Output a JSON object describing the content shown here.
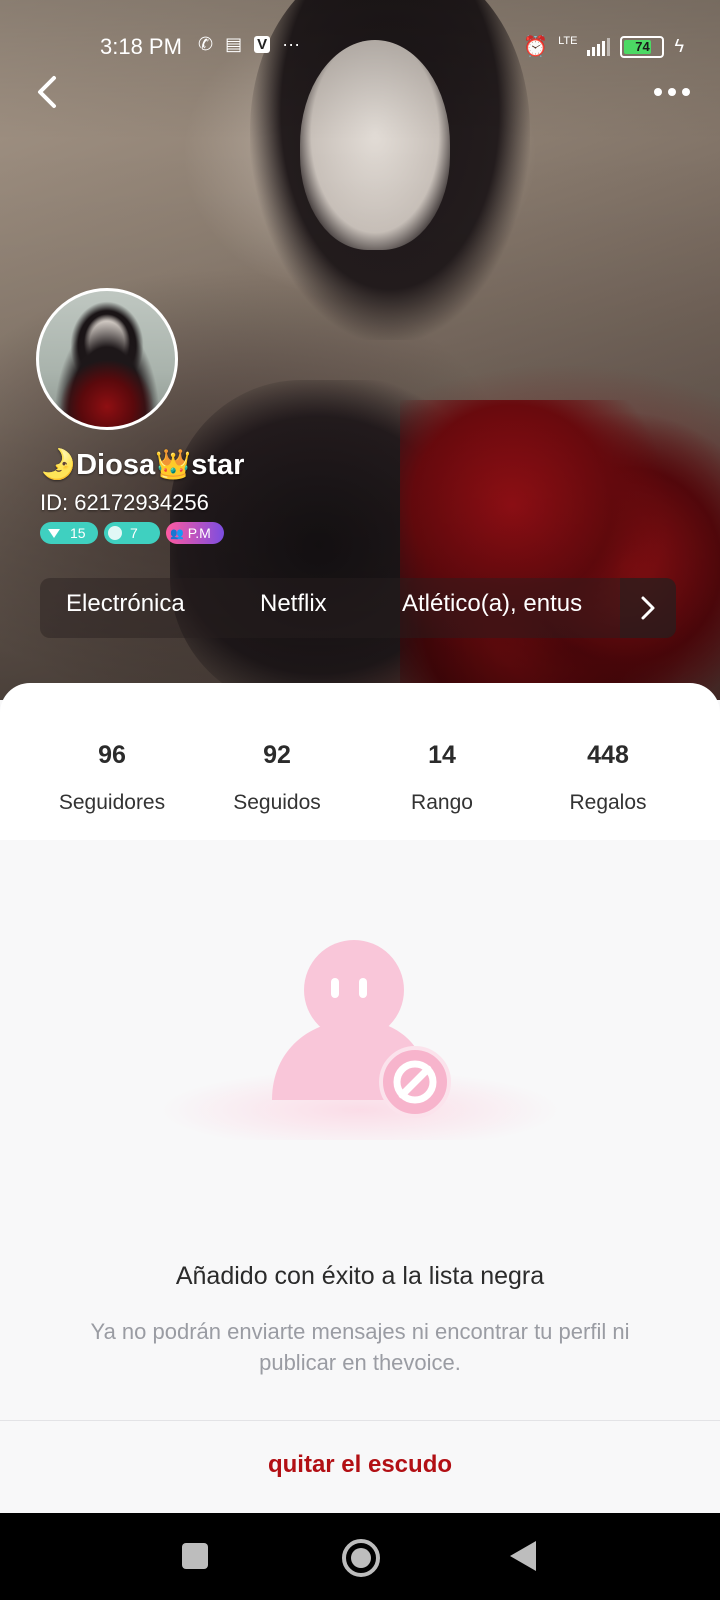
{
  "status_bar": {
    "time": "3:18 PM",
    "network": "LTE",
    "battery_level": "74",
    "battery_fraction": 0.74,
    "icons": [
      "missed-call-icon",
      "message-icon",
      "app-v-icon",
      "more-dots-icon",
      "alarm-icon",
      "signal-icon",
      "battery-icon",
      "charging-icon"
    ]
  },
  "header": {
    "back_icon": "chevron-left-icon",
    "more_icon": "more-horizontal-icon"
  },
  "profile": {
    "name": "🌛Diosa👑star",
    "id_text": "ID: 62172934256",
    "badges": [
      {
        "label": "15",
        "icon": "level-triangle-icon"
      },
      {
        "label": "7",
        "icon": "gem-icon"
      },
      {
        "label": "P.M",
        "icon": "group-icon"
      }
    ],
    "interests": [
      "Electrónica",
      "Netflix",
      "Atlético(a), entus"
    ],
    "interests_more_icon": "chevron-right-icon"
  },
  "stats": [
    {
      "value": "96",
      "label": "Seguidores"
    },
    {
      "value": "92",
      "label": "Seguidos"
    },
    {
      "value": "14",
      "label": "Rango"
    },
    {
      "value": "448",
      "label": "Regalos"
    }
  ],
  "blocked_state": {
    "illustration_icon": "blocked-user-icon",
    "title": "Añadido con éxito a la lista negra",
    "description": "Ya no podrán enviarte mensajes ni encontrar tu perfil ni publicar en thevoice."
  },
  "actions": {
    "remove_shield_label": "quitar el escudo"
  },
  "colors": {
    "accent_red": "#b20f14",
    "badge_teal": "#3fd0c0",
    "illustration_pink": "#f9c6d9"
  }
}
